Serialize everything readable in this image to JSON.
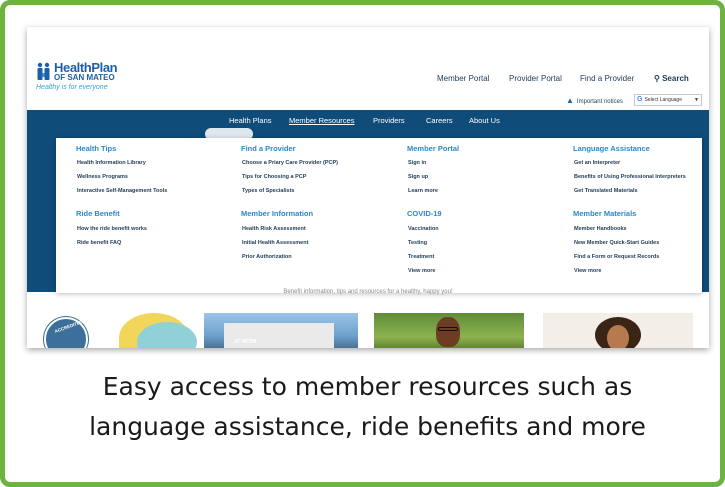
{
  "brand": {
    "name": "HealthPlan",
    "sub": "OF SAN MATEO",
    "tagline": "Healthy is for everyone",
    "colors": {
      "frame": "#6cb33f",
      "navy": "#0f4c7a",
      "accent_blue": "#2c88c9",
      "text_dark": "#1f3b57"
    }
  },
  "header": {
    "links": [
      "Member Portal",
      "Provider Portal",
      "Find a Provider"
    ],
    "search_label": "Search",
    "important_notices": "Important notices",
    "select_language": "Select Language",
    "icons": [
      "alert-triangle-icon",
      "search-icon",
      "google-translate-icon",
      "chevron-down-icon"
    ]
  },
  "nav": {
    "items": [
      "Health Plans",
      "Member Resources",
      "Providers",
      "Careers",
      "About Us"
    ],
    "active": "Member Resources"
  },
  "mega_menu": {
    "columns": [
      {
        "sections": [
          {
            "heading": "Health Tips",
            "links": [
              "Health Information Library",
              "Wellness Programs",
              "Interactive Self-Management Tools"
            ]
          },
          {
            "heading": "Ride Benefit",
            "links": [
              "How the ride benefit works",
              "Ride benefit FAQ"
            ]
          }
        ]
      },
      {
        "sections": [
          {
            "heading": "Find a Provider",
            "links": [
              "Choose a Priary Care Provider (PCP)",
              "Tips for Choosing a PCP",
              "Types of Specialists"
            ]
          },
          {
            "heading": "Member Information",
            "links": [
              "Health Risk Assessment",
              "Initial Health Assessment",
              "Prior Authorization"
            ]
          }
        ]
      },
      {
        "sections": [
          {
            "heading": "Member Portal",
            "links": [
              "Sign in",
              "Sign up",
              "Learn more"
            ]
          },
          {
            "heading": "COVID-19",
            "links": [
              "Vaccination",
              "Testing",
              "Treatment",
              "View more"
            ]
          }
        ]
      },
      {
        "sections": [
          {
            "heading": "Language Assistance",
            "links": [
              "Get an Interpreter",
              "Benefits of Using Professional Interpreters",
              "Get Translated Materials"
            ]
          },
          {
            "heading": "Member Materials",
            "links": [
              "Member Handbooks",
              "New Member Quick-Start Guides",
              "Find a Form or Request Records",
              "View more"
            ]
          }
        ]
      }
    ]
  },
  "page": {
    "tagline": "Benefit information, tips and resources for a healthy, happy you!",
    "badge_text": "ACCREDITED",
    "photo_sign": "AT HPSM"
  },
  "caption": {
    "line1": "Easy access to member resources such as",
    "line2": "language assistance, ride benefits and more"
  }
}
